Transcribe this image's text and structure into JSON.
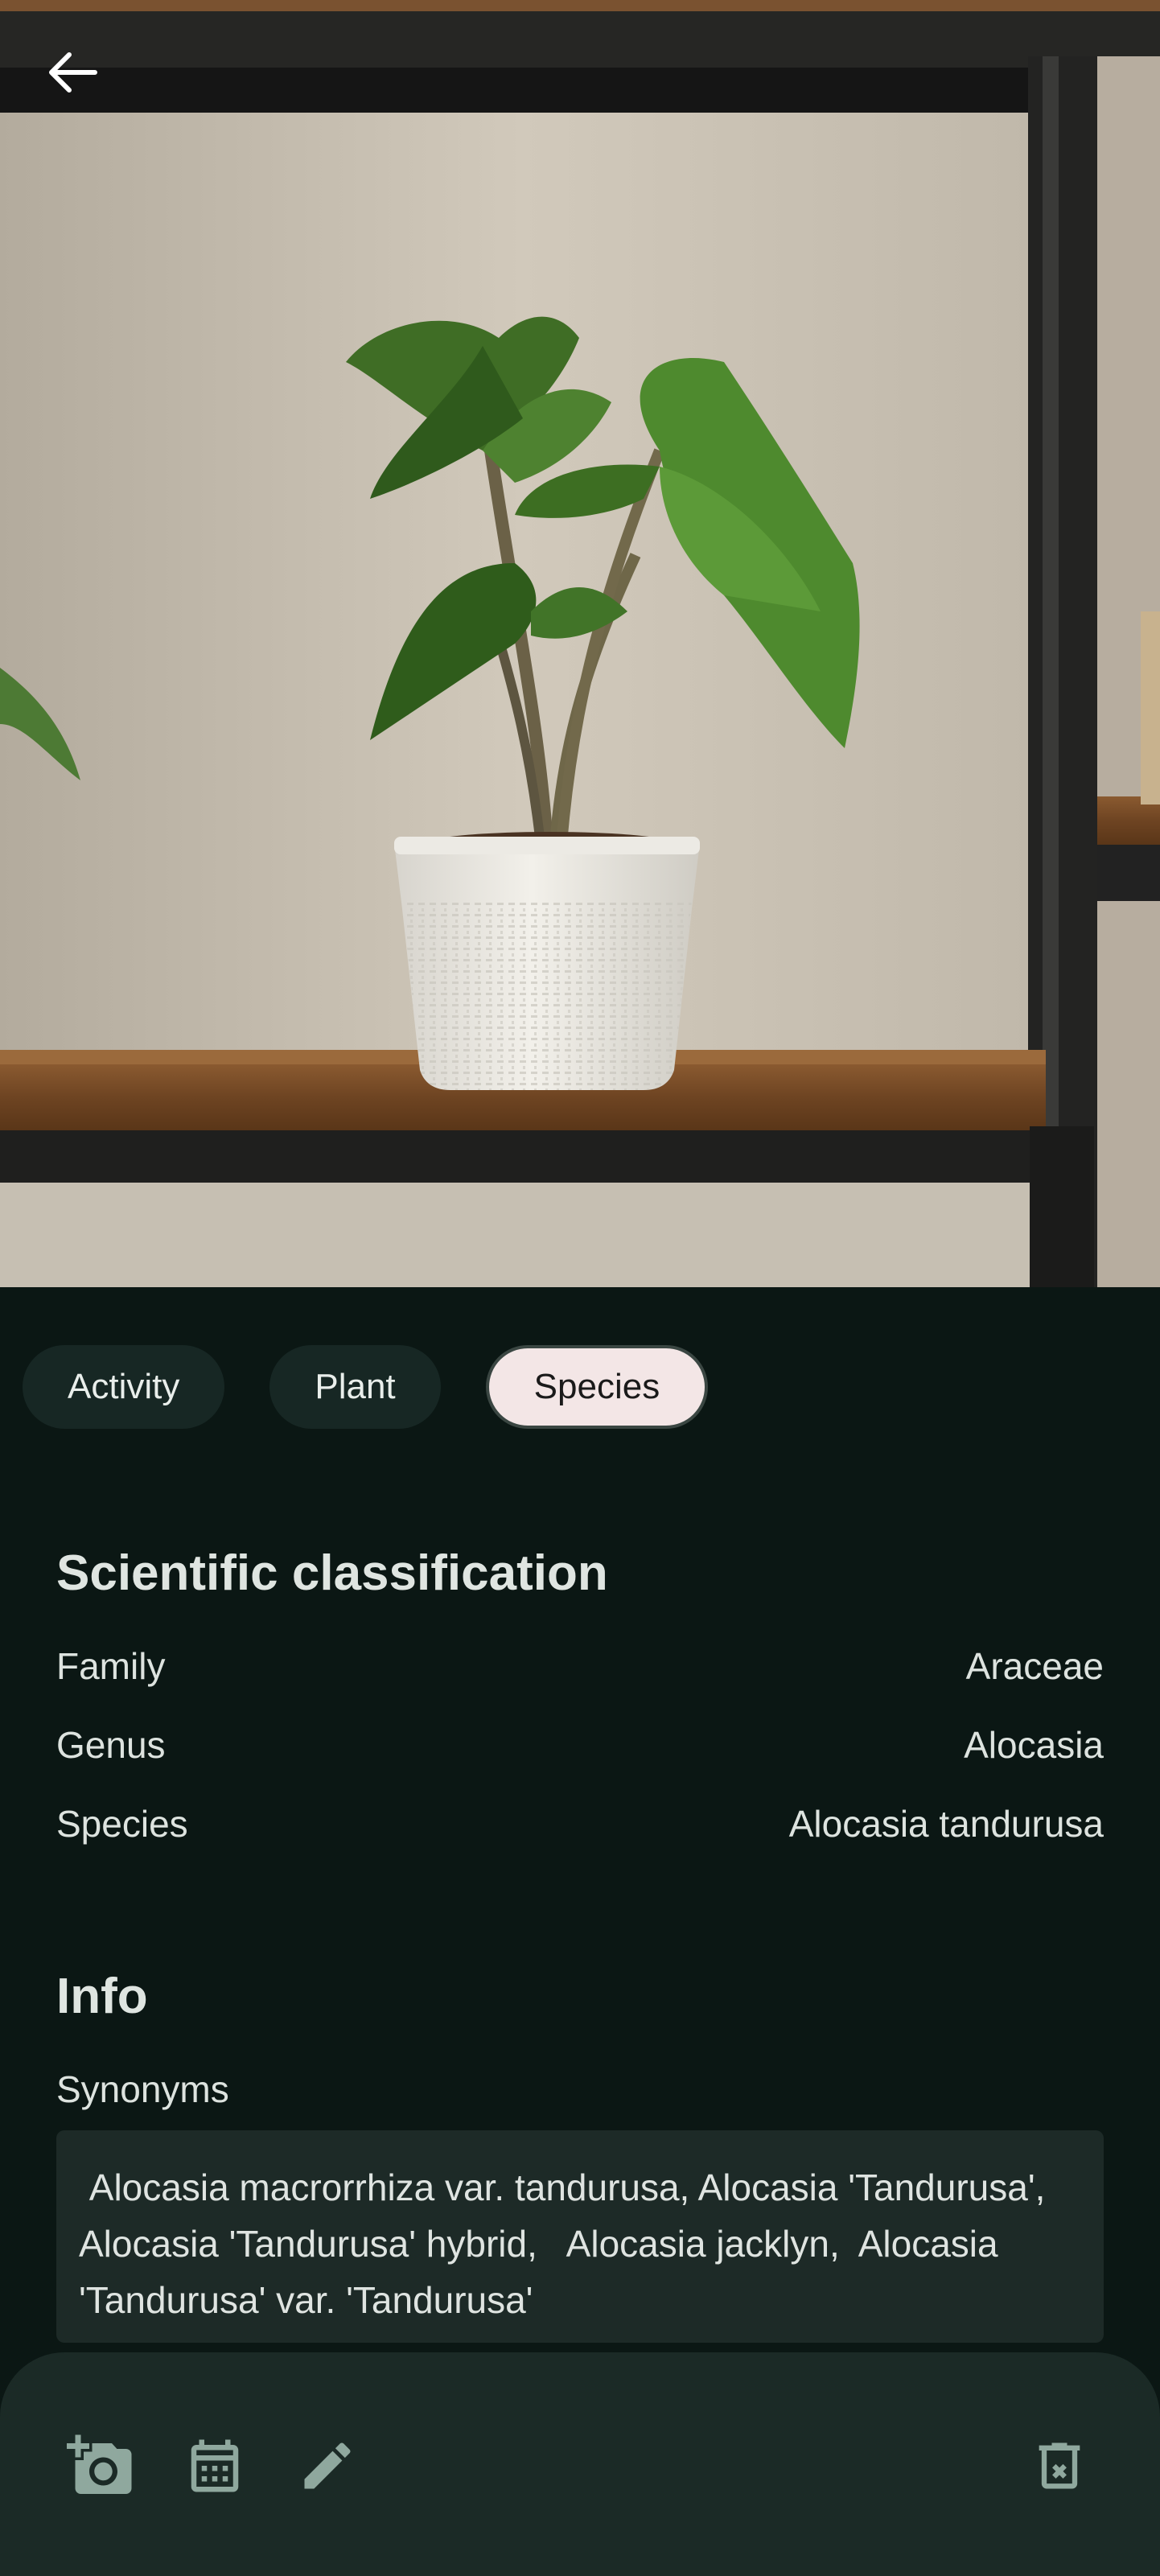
{
  "tabs": [
    {
      "label": "Activity",
      "active": false
    },
    {
      "label": "Plant",
      "active": false
    },
    {
      "label": "Species",
      "active": true
    }
  ],
  "classification": {
    "title": "Scientific classification",
    "rows": [
      {
        "label": "Family",
        "value": "Araceae"
      },
      {
        "label": "Genus",
        "value": "Alocasia"
      },
      {
        "label": "Species",
        "value": "Alocasia tandurusa"
      }
    ]
  },
  "info": {
    "title": "Info",
    "synonyms_label": "Synonyms",
    "synonyms_text": " Alocasia macrorrhiza var. tandurusa, Alocasia 'Tandurusa',  Alocasia 'Tandurusa' hybrid,   Alocasia jacklyn,  Alocasia 'Tandurusa' var. 'Tandurusa'"
  },
  "toolbar": {
    "icons": [
      "add-photo-icon",
      "calendar-icon",
      "edit-icon",
      "delete-icon"
    ]
  },
  "colors": {
    "background": "#0b1714",
    "chip": "#172724",
    "chip_active": "#f3e6e6",
    "bottom_bar": "#1b2a26"
  }
}
